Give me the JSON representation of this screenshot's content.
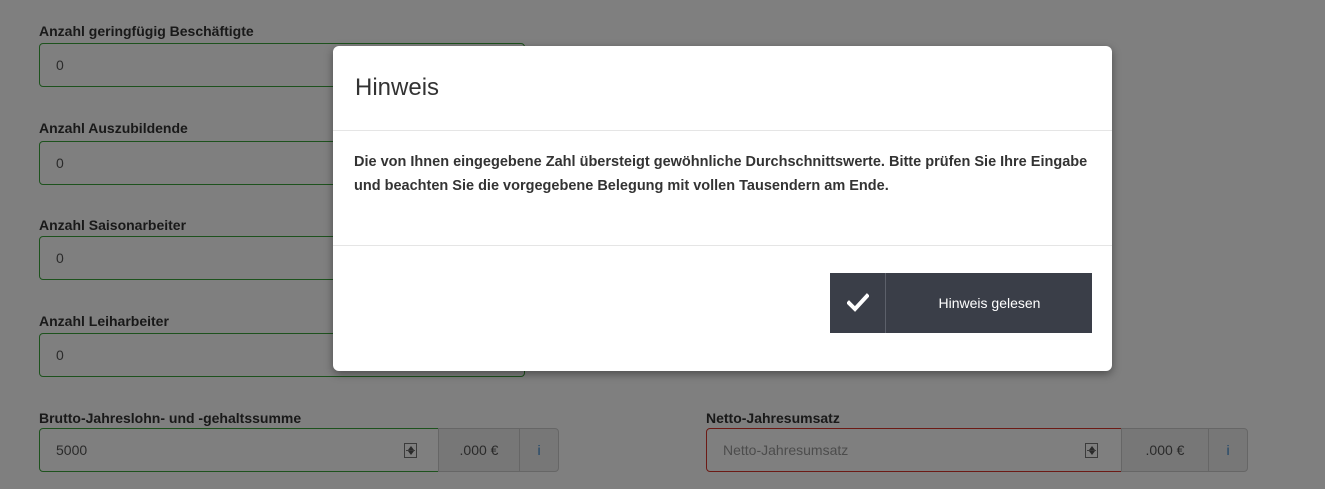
{
  "form": {
    "fields": [
      {
        "label": "Anzahl geringfügig Beschäftigte",
        "value": "0"
      },
      {
        "label": "Anzahl Auszubildende",
        "value": "0"
      },
      {
        "label": "Anzahl Saisonarbeiter",
        "value": "0"
      },
      {
        "label": "Anzahl Leiharbeiter",
        "value": "0"
      }
    ],
    "salary": {
      "label": "Brutto-Jahreslohn- und -gehaltssumme",
      "value": "5000",
      "suffix": ".000 €",
      "info": "i"
    },
    "revenue": {
      "label": "Netto-Jahresumsatz",
      "value": "",
      "placeholder": "Netto-Jahresumsatz",
      "suffix": ".000 €",
      "info": "i"
    }
  },
  "modal": {
    "title": "Hinweis",
    "message": "Die von Ihnen eingegebene Zahl übersteigt gewöhnliche Durchschnittswerte. Bitte prüfen Sie Ihre Eingabe und beachten Sie die vorgegebene Belegung mit vollen Tausendern am Ende.",
    "confirm_label": "Hinweis gelesen",
    "confirm_icon": "checkmark-icon"
  },
  "colors": {
    "valid_border": "#3aa53a",
    "invalid_border": "#d9342b",
    "button_bg": "#3a3e48",
    "info_icon": "#3a8ad1"
  }
}
